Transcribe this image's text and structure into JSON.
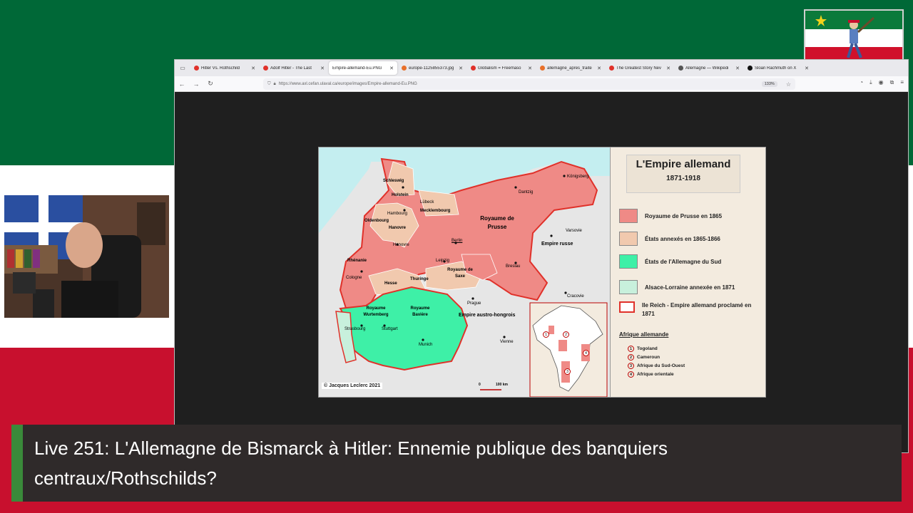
{
  "browser": {
    "tabs": [
      {
        "title": "Hitler Vs. Rothschild",
        "favicon_color": "#e0312a"
      },
      {
        "title": "Adolf Hitler - The Last",
        "favicon_color": "#e0312a"
      },
      {
        "title": "Empire-allemand-Eu.PNG",
        "favicon_color": "#cccccc"
      },
      {
        "title": "europe-1125855373.jpg",
        "favicon_color": "#e8702a"
      },
      {
        "title": "Globalism = Freemaso",
        "favicon_color": "#e0312a"
      },
      {
        "title": "allemagne_apres_traite",
        "favicon_color": "#e8702a"
      },
      {
        "title": "The Greatest Story Nev",
        "favicon_color": "#e0312a"
      },
      {
        "title": "Allemagne — Wikipédi",
        "favicon_color": "#555555"
      },
      {
        "title": "Sloan Rachmuth on X",
        "favicon_color": "#111111"
      }
    ],
    "active_tab_index": 2,
    "url": "https://www.axl.cefan.ulaval.ca/europe/images/Empire-allemand-Eu.PNG",
    "zoom": "133%"
  },
  "map": {
    "title": "L'Empire allemand",
    "years": "1871-1918",
    "legend": [
      {
        "label": "Royaume de Prusse en 1865",
        "color": "#ef8a86"
      },
      {
        "label": "États annexés en 1865-1866",
        "color": "#f1c9ae"
      },
      {
        "label": "États de l'Allemagne du Sud",
        "color": "#3ef0a7"
      },
      {
        "label": "Alsace-Lorraine annexée en 1871",
        "color": "#c8f0dc"
      },
      {
        "label": "IIe Reich - Empire allemand proclamé en 1871",
        "color": "#ffffff"
      }
    ],
    "africa_title": "Afrique allemande",
    "africa_items": [
      {
        "num": "1",
        "label": "Togoland"
      },
      {
        "num": "2",
        "label": "Cameroun"
      },
      {
        "num": "3",
        "label": "Afrique du Sud-Ouest"
      },
      {
        "num": "4",
        "label": "Afrique orientale"
      }
    ],
    "labels": {
      "schleswig": "Schleswig",
      "holstein": "Holstein",
      "lubeck": "Lübeck",
      "mecklembourg": "Mecklembourg",
      "hambourg": "Hambourg",
      "oldenbourg": "Oldenbourg",
      "hanovre": "Hanovre",
      "hanovre_city": "Hanovre",
      "prusse": "Royaume de Prusse",
      "dantzig": "Dantzig",
      "konigsberg": "Königsberg",
      "varsovie": "Varsovie",
      "empire_russe": "Empire russe",
      "berlin": "Berlin",
      "rhenanie": "Rhénanie",
      "cologne": "Cologne",
      "leipzig": "Leipzig",
      "saxe": "Royaume de Saxe",
      "thuringe": "Thuringe",
      "hesse": "Hesse",
      "breslau": "Breslau",
      "cracovie": "Cracovie",
      "prague": "Prague",
      "autriche": "Empire austro-hongrois",
      "wurtemberg": "Royaume Wurtemberg",
      "baviere": "Royaume Bavière",
      "strasbourg": "Strasbourg",
      "stuttgart": "Stuttgart",
      "munich": "Munich",
      "vienne": "Vienne",
      "scale": "100 km",
      "scale_zero": "0"
    },
    "credit": "© Jacques Leclerc 2021"
  },
  "caption": {
    "text": "Live 251: L'Allemagne de Bismarck à Hitler: Ennemie publique des banquiers centraux/Rothschilds?"
  }
}
